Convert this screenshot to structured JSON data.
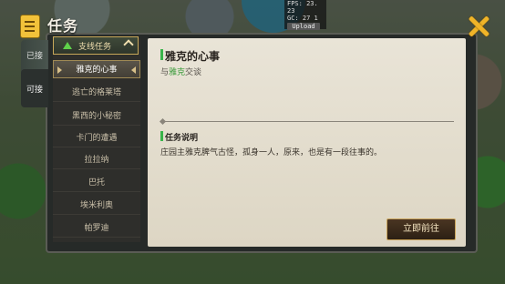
{
  "debug": {
    "fps": "FPS: 23. 23",
    "gc": "GC: 27  1",
    "upload": "Upload"
  },
  "header": {
    "title": "任务",
    "icon": "quest-scroll-icon",
    "close_icon": "close-icon"
  },
  "side_tabs": [
    "已接",
    "可接"
  ],
  "category": {
    "label": "支线任务",
    "icon": "triangle-icon",
    "expanded": true
  },
  "quests": [
    {
      "name": "雅克的心事",
      "selected": true
    },
    {
      "name": "逃亡的格莱塔",
      "selected": false
    },
    {
      "name": "黑西的小秘密",
      "selected": false
    },
    {
      "name": "卡门的遭遇",
      "selected": false
    },
    {
      "name": "拉拉纳",
      "selected": false
    },
    {
      "name": "巴托",
      "selected": false
    },
    {
      "name": "埃米利奥",
      "selected": false
    },
    {
      "name": "帕罗迪",
      "selected": false
    }
  ],
  "detail": {
    "title": "雅克的心事",
    "goal_prefix": "与",
    "goal_target": "雅克",
    "goal_suffix": "交谈",
    "section_title": "任务说明",
    "description": "庄园主雅克脾气古怪，孤身一人，原来，也是有一段往事的。",
    "go_button": "立即前往"
  },
  "colors": {
    "accent_green": "#39b44a",
    "gold": "#f0b428",
    "panel": "#e9e4d7"
  }
}
